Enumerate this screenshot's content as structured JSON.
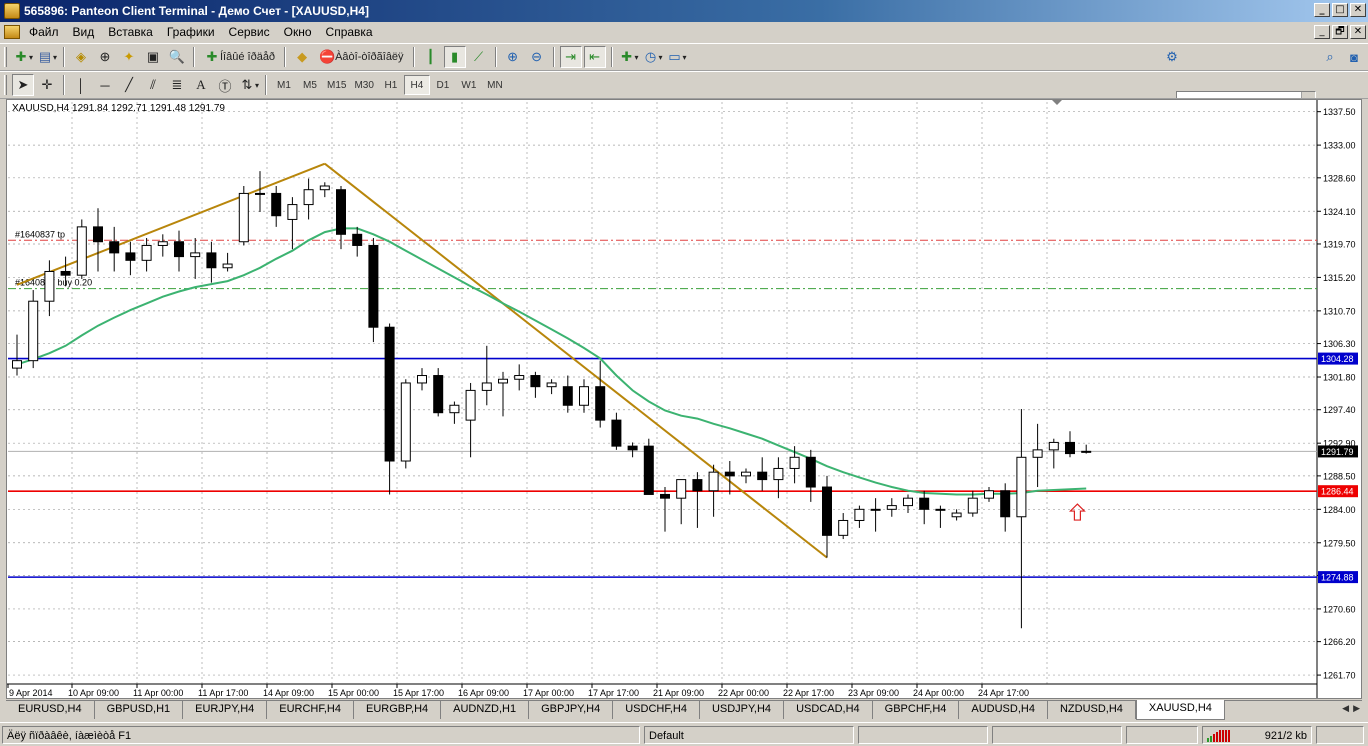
{
  "window": {
    "title": "565896: Panteon Client Terminal - Демо Счет - [XAUUSD,H4]",
    "buttons": [
      "_",
      "□",
      "✕"
    ],
    "mdi_buttons": [
      "_",
      "🗗",
      "✕"
    ]
  },
  "menu": [
    "Файл",
    "Вид",
    "Вставка",
    "Графики",
    "Сервис",
    "Окно",
    "Справка"
  ],
  "toolbar1": {
    "new_order_label": "Íîâûé îðäåð",
    "experts_label": "Àâòî-òîðãîâëÿ"
  },
  "timeframes": [
    "M1",
    "M5",
    "M15",
    "M30",
    "H1",
    "H4",
    "D1",
    "W1",
    "MN"
  ],
  "active_timeframe": "H4",
  "chart": {
    "header": "XAUUSD,H4  1291.84 1292.71 1291.48 1291.79",
    "order_label_tp": "#1640837 tp",
    "order_label_buy": "#1640837 buy 0.20",
    "price_ticks": [
      "1337.50",
      "1333.00",
      "1328.60",
      "1324.10",
      "1319.70",
      "1315.20",
      "1310.70",
      "1306.30",
      "1301.80",
      "1297.40",
      "1292.90",
      "1288.50",
      "1284.00",
      "1279.50",
      "1275.10",
      "1270.60",
      "1266.20",
      "1261.70"
    ],
    "time_ticks": [
      "9 Apr 2014",
      "10 Apr 09:00",
      "11 Apr 00:00",
      "11 Apr 17:00",
      "14 Apr 09:00",
      "15 Apr 00:00",
      "15 Apr 17:00",
      "16 Apr 09:00",
      "17 Apr 00:00",
      "17 Apr 17:00",
      "21 Apr 09:00",
      "22 Apr 00:00",
      "22 Apr 17:00",
      "23 Apr 09:00",
      "24 Apr 00:00",
      "24 Apr 17:00"
    ],
    "hlines": [
      {
        "label": "1304.28",
        "color": "#0000cc",
        "price": 1304.28
      },
      {
        "label": "1291.79",
        "color": "#b0b0b0",
        "price": 1291.79,
        "bg": "#000000"
      },
      {
        "label": "1286.44",
        "color": "#ee0000",
        "price": 1286.44
      },
      {
        "label": "1274.88",
        "color": "#0000cc",
        "price": 1274.88
      }
    ],
    "tp_price": 1320.2,
    "entry_price": 1313.7,
    "colors": {
      "trend": "#b8860b",
      "ma": "#3cb371",
      "bull": "#ffffff",
      "bear": "#000000",
      "grid": "#a0a0a0",
      "arrow": "#dd2222"
    }
  },
  "chart_data": {
    "type": "candlestick",
    "symbol": "XAUUSD",
    "timeframe": "H4",
    "ylim": [
      1260.5,
      1338.8
    ],
    "candles": [
      [
        1303.0,
        1307.5,
        1302.0,
        1304.0
      ],
      [
        1304.0,
        1313.5,
        1303.0,
        1312.0
      ],
      [
        1312.0,
        1317.5,
        1310.0,
        1316.0
      ],
      [
        1316.0,
        1318.0,
        1314.0,
        1315.5
      ],
      [
        1315.5,
        1323.0,
        1315.0,
        1322.0
      ],
      [
        1322.0,
        1324.5,
        1316.0,
        1320.0
      ],
      [
        1320.0,
        1322.0,
        1316.0,
        1318.5
      ],
      [
        1318.5,
        1320.0,
        1315.5,
        1317.5
      ],
      [
        1317.5,
        1320.5,
        1316.0,
        1319.5
      ],
      [
        1319.5,
        1321.0,
        1318.0,
        1320.0
      ],
      [
        1320.0,
        1321.5,
        1316.0,
        1318.0
      ],
      [
        1318.0,
        1320.5,
        1315.0,
        1318.5
      ],
      [
        1318.5,
        1320.0,
        1314.5,
        1316.5
      ],
      [
        1316.5,
        1318.5,
        1316.0,
        1317.0
      ],
      [
        1320.0,
        1327.5,
        1319.5,
        1326.5
      ],
      [
        1326.5,
        1329.5,
        1324.0,
        1326.5
      ],
      [
        1326.5,
        1327.5,
        1322.0,
        1323.5
      ],
      [
        1323.0,
        1326.0,
        1319.0,
        1325.0
      ],
      [
        1325.0,
        1328.5,
        1323.0,
        1327.0
      ],
      [
        1327.0,
        1328.0,
        1326.0,
        1327.5
      ],
      [
        1327.0,
        1327.5,
        1319.0,
        1321.0
      ],
      [
        1321.0,
        1322.0,
        1318.0,
        1319.5
      ],
      [
        1319.5,
        1320.5,
        1306.5,
        1308.5
      ],
      [
        1308.5,
        1309.0,
        1286.0,
        1290.5
      ],
      [
        1290.5,
        1301.5,
        1289.5,
        1301.0
      ],
      [
        1301.0,
        1303.0,
        1300.0,
        1302.0
      ],
      [
        1302.0,
        1303.0,
        1296.5,
        1297.0
      ],
      [
        1297.0,
        1298.5,
        1295.5,
        1298.0
      ],
      [
        1296.0,
        1301.0,
        1291.0,
        1300.0
      ],
      [
        1300.0,
        1306.0,
        1298.0,
        1301.0
      ],
      [
        1301.0,
        1302.5,
        1296.5,
        1301.5
      ],
      [
        1301.5,
        1303.5,
        1300.0,
        1302.0
      ],
      [
        1302.0,
        1302.5,
        1299.0,
        1300.5
      ],
      [
        1300.5,
        1301.5,
        1299.5,
        1301.0
      ],
      [
        1300.5,
        1302.0,
        1297.0,
        1298.0
      ],
      [
        1298.0,
        1301.5,
        1297.0,
        1300.5
      ],
      [
        1300.5,
        1304.0,
        1295.0,
        1296.0
      ],
      [
        1296.0,
        1297.0,
        1292.0,
        1292.5
      ],
      [
        1292.5,
        1293.0,
        1291.0,
        1292.0
      ],
      [
        1292.5,
        1293.5,
        1286.0,
        1286.0
      ],
      [
        1286.0,
        1287.0,
        1281.0,
        1285.5
      ],
      [
        1285.5,
        1287.5,
        1282.0,
        1288.0
      ],
      [
        1288.0,
        1289.0,
        1281.5,
        1286.5
      ],
      [
        1286.5,
        1290.0,
        1283.0,
        1289.0
      ],
      [
        1289.0,
        1290.5,
        1286.0,
        1288.5
      ],
      [
        1288.5,
        1289.5,
        1287.5,
        1289.0
      ],
      [
        1289.0,
        1291.0,
        1286.5,
        1288.0
      ],
      [
        1288.0,
        1291.0,
        1285.5,
        1289.5
      ],
      [
        1289.5,
        1292.5,
        1287.5,
        1291.0
      ],
      [
        1291.0,
        1292.0,
        1285.0,
        1287.0
      ],
      [
        1287.0,
        1288.5,
        1277.5,
        1280.5
      ],
      [
        1280.5,
        1283.5,
        1280.0,
        1282.5
      ],
      [
        1282.5,
        1284.5,
        1281.5,
        1284.0
      ],
      [
        1284.0,
        1285.5,
        1281.0,
        1284.0
      ],
      [
        1284.0,
        1285.5,
        1283.0,
        1284.5
      ],
      [
        1284.5,
        1286.0,
        1283.5,
        1285.5
      ],
      [
        1285.5,
        1286.5,
        1282.0,
        1284.0
      ],
      [
        1284.0,
        1284.5,
        1281.5,
        1284.0
      ],
      [
        1283.0,
        1284.0,
        1282.5,
        1283.5
      ],
      [
        1283.5,
        1286.5,
        1283.0,
        1285.5
      ],
      [
        1285.5,
        1287.0,
        1285.0,
        1286.5
      ],
      [
        1286.5,
        1287.5,
        1281.0,
        1283.0
      ],
      [
        1283.0,
        1297.5,
        1268.0,
        1291.0
      ],
      [
        1291.0,
        1295.5,
        1287.0,
        1292.0
      ],
      [
        1292.0,
        1293.5,
        1289.5,
        1293.0
      ],
      [
        1293.0,
        1294.5,
        1291.0,
        1291.5
      ],
      [
        1291.8,
        1292.7,
        1291.5,
        1291.8
      ]
    ],
    "ma_series": [
      1303.5,
      1304.2,
      1305.0,
      1306.0,
      1307.4,
      1308.7,
      1309.8,
      1310.8,
      1311.7,
      1312.6,
      1313.3,
      1313.9,
      1314.3,
      1314.7,
      1315.5,
      1316.5,
      1317.7,
      1318.8,
      1320.2,
      1321.3,
      1321.8,
      1321.8,
      1321.0,
      1320.0,
      1318.8,
      1317.6,
      1316.4,
      1315.2,
      1314.0,
      1312.9,
      1311.7,
      1310.6,
      1309.4,
      1308.2,
      1307.0,
      1305.7,
      1304.3,
      1302.0,
      1300.0,
      1298.5,
      1297.3,
      1296.6,
      1296.2,
      1295.5,
      1294.9,
      1294.2,
      1293.5,
      1292.6,
      1291.7,
      1290.8,
      1289.8,
      1289.0,
      1288.3,
      1287.6,
      1287.0,
      1286.5,
      1286.2,
      1286.1,
      1286.0,
      1286.0,
      1286.1,
      1286.1,
      1286.2,
      1286.5,
      1286.6,
      1286.7,
      1286.8
    ],
    "trendlines": [
      {
        "from": [
          0,
          1314.2
        ],
        "to": [
          19,
          1330.5
        ]
      },
      {
        "from": [
          19,
          1330.5
        ],
        "to": [
          50,
          1277.5
        ]
      }
    ]
  },
  "tabs": [
    "EURUSD,H4",
    "GBPUSD,H1",
    "EURJPY,H4",
    "EURCHF,H4",
    "EURGBP,H4",
    "AUDNZD,H1",
    "GBPJPY,H4",
    "USDCHF,H4",
    "USDJPY,H4",
    "USDCAD,H4",
    "GBPCHF,H4",
    "AUDUSD,H4",
    "NZDUSD,H4",
    "XAUUSD,H4"
  ],
  "active_tab": "XAUUSD,H4",
  "status": {
    "help": "Äëÿ ñïðàâêè, íàæìèòå F1",
    "profile": "Default",
    "traffic": "921/2 kb"
  }
}
